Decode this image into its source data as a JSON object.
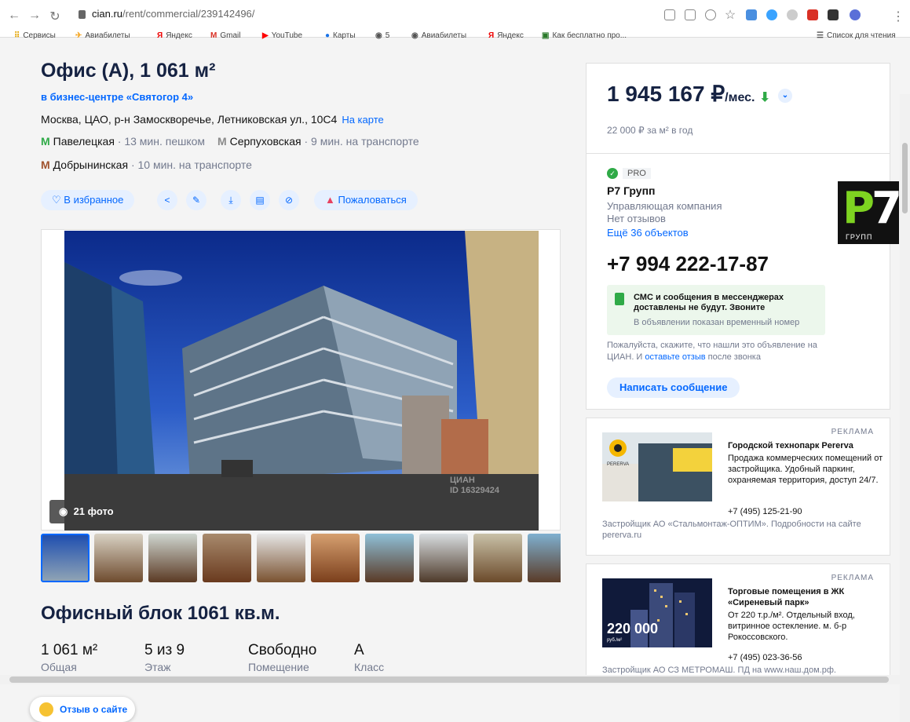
{
  "browser": {
    "url_host": "cian.ru",
    "url_path": "/rent/commercial/239142496/",
    "bookmarks": [
      "Сервисы",
      "Авиабилеты",
      "Яндекс",
      "Gmail",
      "YouTube",
      "Карты",
      "5",
      "Авиабилеты",
      "Яндекс",
      "Как бесплатно про..."
    ],
    "reading_list": "Список для чтения"
  },
  "listing": {
    "title": "Офис (А), 1 061 м²",
    "business_center": "в бизнес-центре «Святогор 4»",
    "address": "Москва, ЦАО, р-н Замоскворечье, Летниковская ул., 10С4",
    "map_link": "На карте",
    "metro": [
      {
        "name": "Павелецкая",
        "time": "· 13 мин. пешком",
        "color": "#2faa47"
      },
      {
        "name": "Серпуховская",
        "time": "· 9 мин. на транспорте",
        "color": "#8a8a8a"
      },
      {
        "name": "Добрынинская",
        "time": "· 10 мин. на транспорте",
        "color": "#a0522d"
      }
    ],
    "actions": {
      "favorite": "В избранное",
      "report": "Пожаловаться"
    },
    "photo_count": "21 фото",
    "watermark_brand": "ЦИАН",
    "watermark_id": "ID 16329424",
    "section_title": "Офисный блок 1061 кв.м.",
    "features": [
      {
        "value": "1 061 м²",
        "label": "Общая"
      },
      {
        "value": "5 из 9",
        "label": "Этаж"
      },
      {
        "value": "Свободно",
        "label": "Помещение"
      },
      {
        "value": "А",
        "label": "Класс"
      }
    ],
    "feedback": "Отзыв о сайте"
  },
  "offer": {
    "price": "1 945 167 ₽",
    "price_unit": "/мес.",
    "price_per_m2": "22 000 ₽ за м² в год",
    "pro": "PRO",
    "agency_name": "Р7 Групп",
    "agency_role": "Управляющая компания",
    "reviews": "Нет отзывов",
    "more_objects": "Ещё 36 объектов",
    "logo_text": "ГРУПП",
    "phone": "+7 994 222-17-87",
    "sms_notice": "СМС и сообщения в мессенджерах доставлены не будут. Звоните",
    "temp_number": "В объявлении показан временный номер",
    "please_text_1": "Пожалуйста, скажите, что нашли это объявление на ЦИАН. И",
    "please_link": "оставьте отзыв",
    "please_text_2": "после звонка",
    "message_button": "Написать сообщение"
  },
  "ads": [
    {
      "label": "РЕКЛАМА",
      "title": "Городской технопарк Pererva",
      "text": "Продажа коммерческих помещений от застройщика. Удобный паркинг, охраняемая территория, доступ 24/7.",
      "phone": "+7 (495) 125-21-90",
      "footer": "Застройщик АО «Стальмонтаж-ОПТИМ». Подробности на сайте pererva.ru",
      "logo": "PERERVA"
    },
    {
      "label": "РЕКЛАМА",
      "title": "Торговые помещения в ЖК «Сиреневый парк»",
      "text": "От 220 т.р./м². Отдельный вход, витринное остекление. м. б-р Рокоссовского.",
      "phone": "+7 (495) 023-36-56",
      "footer": "Застройщик АО СЗ МЕТРОМАШ. ПД на www.наш.дом.рф.",
      "badge": "220 000",
      "badge_unit": "руб./м²"
    }
  ]
}
